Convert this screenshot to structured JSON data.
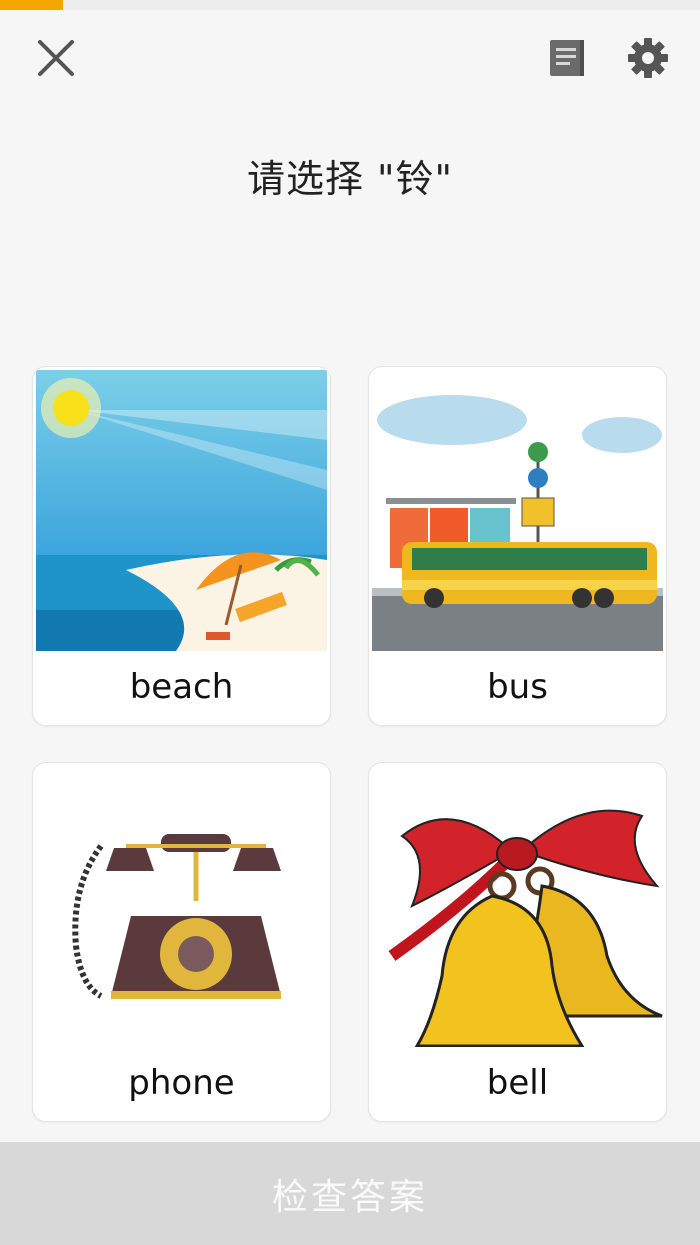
{
  "progress": {
    "fraction": 0.09
  },
  "toolbar": {
    "close_icon": "close-icon",
    "notes_icon": "notes-icon",
    "settings_icon": "gear-icon"
  },
  "question": {
    "prompt": "请选择 \"铃\""
  },
  "options": [
    {
      "id": "beach",
      "label": "beach",
      "image": "beach-umbrella-image"
    },
    {
      "id": "bus",
      "label": "bus",
      "image": "bus-stop-image"
    },
    {
      "id": "phone",
      "label": "phone",
      "image": "rotary-phone-image"
    },
    {
      "id": "bell",
      "label": "bell",
      "image": "christmas-bells-image"
    }
  ],
  "check_button": {
    "label": "检查答案",
    "enabled": false
  },
  "colors": {
    "progress": "#f5a700",
    "button_disabled": "#d8d8d8",
    "background": "#f6f6f6"
  }
}
